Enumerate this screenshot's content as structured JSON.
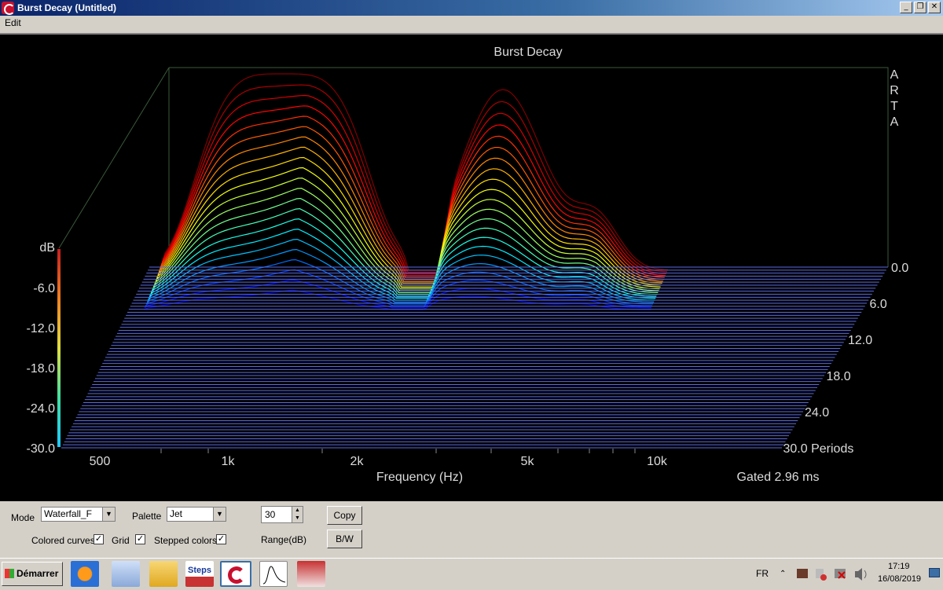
{
  "window": {
    "title": "Burst Decay  (Untitled)",
    "minimize": "_",
    "restore": "❐",
    "close": "✕"
  },
  "menu": {
    "edit": "Edit"
  },
  "plot": {
    "title": "Burst Decay",
    "brand": [
      "A",
      "R",
      "T",
      "A"
    ],
    "db_unit": "dB",
    "db_ticks": [
      "-6.0",
      "-12.0",
      "-18.0",
      "-24.0",
      "-30.0"
    ],
    "freq_ticks": [
      "500",
      "1k",
      "2k",
      "5k",
      "10k"
    ],
    "xlabel": "Frequency (Hz)",
    "period_ticks": [
      "0.0",
      "6.0",
      "12.0",
      "18.0",
      "24.0",
      "30.0 Periods"
    ],
    "gated": "Gated 2.96 ms",
    "colors": {
      "background": "#000000",
      "floor": "#5a6ae0",
      "high": "#c81e1e",
      "low": "#1eb4dc"
    }
  },
  "chart_data": {
    "type": "heatmap",
    "title": "Burst Decay",
    "xlabel": "Frequency (Hz)",
    "ylabel": "dB",
    "zlabel": "Periods",
    "x_scale": "log",
    "x_ticks": [
      500,
      1000,
      2000,
      5000,
      10000
    ],
    "db_range": [
      -30,
      0
    ],
    "periods_range": [
      0,
      30
    ],
    "gated_ms": 2.96
  },
  "controls": {
    "mode_label": "Mode",
    "mode_value": "Waterfall_F",
    "palette_label": "Palette",
    "palette_value": "Jet",
    "range_value": "30",
    "range_label": "Range(dB)",
    "copy_label": "Copy",
    "bw_label": "B/W",
    "colored_curves_label": "Colored curves",
    "grid_label": "Grid",
    "stepped_colors_label": "Stepped colors",
    "check": "✓"
  },
  "taskbar": {
    "start_label": "Démarrer",
    "lang": "FR",
    "time": "17:19",
    "date": "16/08/2019",
    "steps_label": "Steps"
  }
}
